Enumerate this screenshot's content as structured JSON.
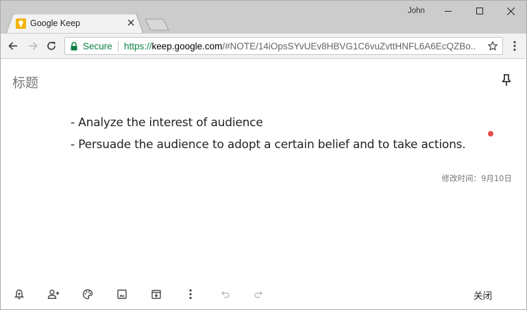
{
  "window": {
    "user": "John"
  },
  "tab": {
    "title": "Google Keep",
    "favicon": "keep-bulb-icon"
  },
  "address_bar": {
    "secure_label": "Secure",
    "url_scheme": "https://",
    "url_host": "keep.google.com",
    "url_path": "/#NOTE/14iOpsSYvUEv8HBVG1C6vuZvttHNFL6A6EcQZBo..."
  },
  "note": {
    "title_placeholder": "标题",
    "lines": [
      "- Analyze the interest of audience",
      "- Persuade the audience to adopt a certain belief and to take actions."
    ],
    "edited_label": "修改时间：9月10日"
  },
  "bottom_bar": {
    "icons": [
      "remind-me-icon",
      "collaborator-icon",
      "palette-icon",
      "image-icon",
      "archive-icon",
      "more-vert-icon",
      "undo-icon",
      "redo-icon"
    ],
    "close_label": "关闭"
  },
  "colors": {
    "titlebar": "#cccccc",
    "toolbar": "#f2f2f2",
    "secure_green": "#0b8043",
    "keep_yellow": "#f5b400",
    "red_dot": "#e54b4b"
  }
}
